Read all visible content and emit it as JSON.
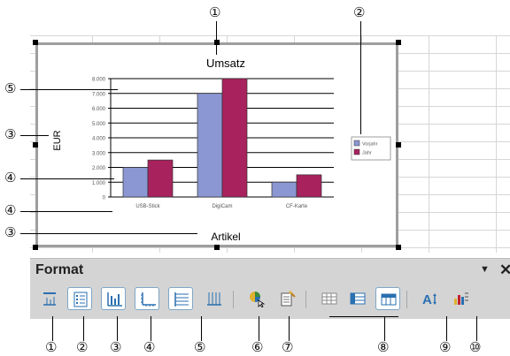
{
  "callouts": {
    "c1": "①",
    "c2": "②",
    "c3": "③",
    "c4": "④",
    "c5": "⑤",
    "c6": "⑥",
    "c7": "⑦",
    "c8": "⑧",
    "c9": "⑨",
    "c10": "⑩"
  },
  "toolbar": {
    "title": "Format",
    "menu_glyph": "▼",
    "close_glyph": "✕",
    "buttons": [
      {
        "icon": "chart-title-icon",
        "selected": false
      },
      {
        "icon": "legend-icon",
        "selected": true
      },
      {
        "icon": "axis-titles-icon",
        "selected": true
      },
      {
        "icon": "axes-icon",
        "selected": true
      },
      {
        "icon": "horizontal-gridlines-icon",
        "selected": true
      },
      {
        "icon": "vertical-gridlines-icon",
        "selected": false
      },
      {
        "icon": "chart-type-icon",
        "selected": false
      },
      {
        "icon": "autoformat-icon",
        "selected": false
      },
      {
        "icon": "data-table-icon",
        "selected": false
      },
      {
        "icon": "data-in-rows-icon",
        "selected": false
      },
      {
        "icon": "data-in-columns-icon",
        "selected": true
      },
      {
        "icon": "text-scale-icon",
        "selected": false
      },
      {
        "icon": "default-format-icon",
        "selected": false
      }
    ]
  },
  "colors": {
    "series1": "#8b97d2",
    "series2": "#a8225e",
    "toolbar_bg": "#d4d4d4",
    "selected_border": "#7ea6c8"
  },
  "chart_data": {
    "type": "bar",
    "title": "Umsatz",
    "xlabel": "Artikel",
    "ylabel": "EUR",
    "categories": [
      "USB-Stick",
      "DigiCam",
      "CF-Karte"
    ],
    "yticks": [
      "8.000",
      "7.000",
      "6.000",
      "5.000",
      "4.000",
      "3.000",
      "2.000",
      "1.000",
      "0"
    ],
    "ylim": [
      0,
      8000
    ],
    "grid": true,
    "legend_position": "right",
    "series": [
      {
        "name": "Vorjahr",
        "values": [
          2000,
          7000,
          1000
        ],
        "color": "#8b97d2"
      },
      {
        "name": "Jahr",
        "values": [
          2500,
          8000,
          1500
        ],
        "color": "#a8225e"
      }
    ]
  }
}
